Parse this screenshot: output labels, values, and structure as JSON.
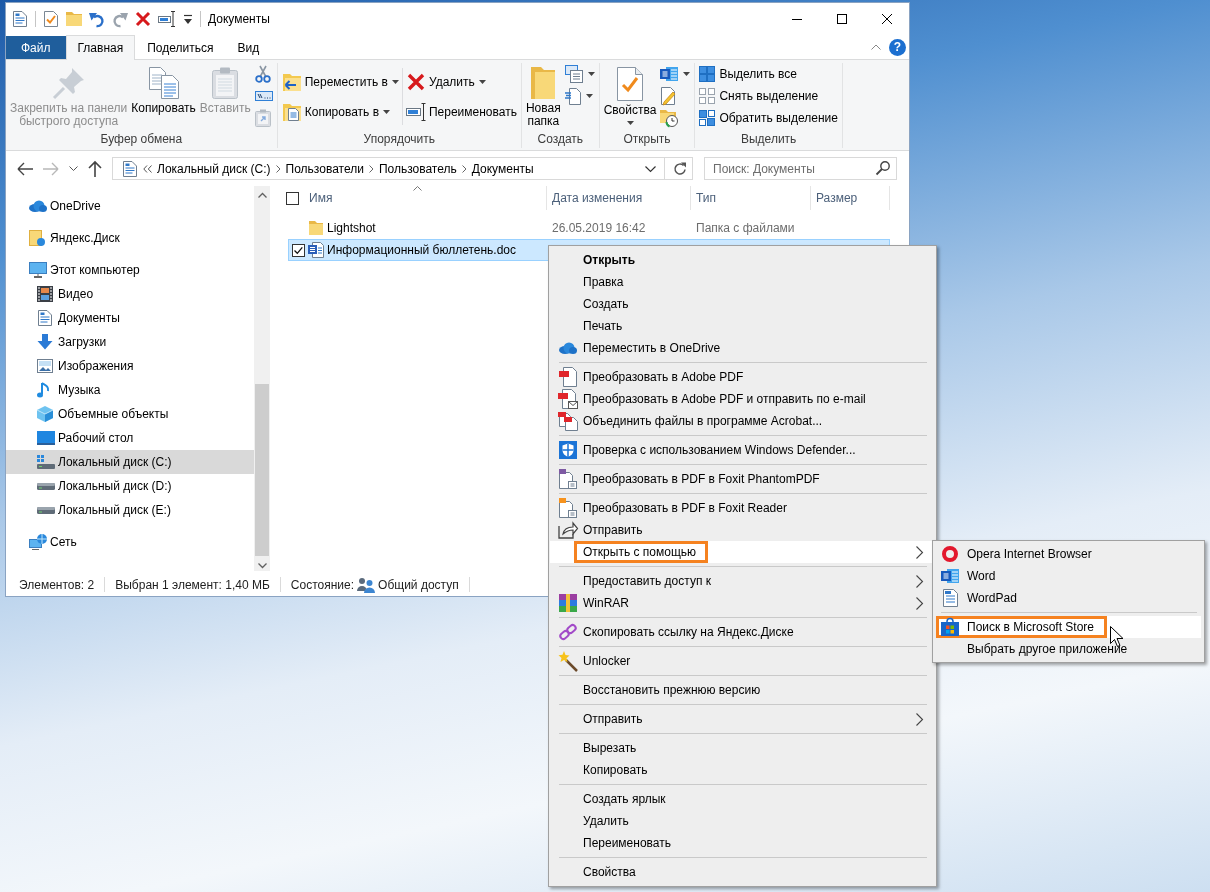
{
  "window": {
    "title": "Документы",
    "help": "?"
  },
  "ribbon": {
    "tabs": [
      {
        "label": "Файл",
        "kind": "file",
        "selected": false
      },
      {
        "label": "Главная",
        "kind": "tab",
        "selected": true
      },
      {
        "label": "Поделиться",
        "kind": "tab",
        "selected": false
      },
      {
        "label": "Вид",
        "kind": "tab",
        "selected": false
      }
    ],
    "groups": [
      {
        "label": "Буфер обмена",
        "columns": [
          [
            {
              "label": "Закрепить на панели\nбыстрого доступа",
              "kind": "large",
              "menu": false,
              "disabled": true
            }
          ],
          [
            {
              "label": "Копировать",
              "kind": "large",
              "menu": false,
              "disabled": false
            }
          ],
          [
            {
              "label": "Вставить",
              "kind": "large",
              "menu": false,
              "disabled": true
            }
          ],
          [
            {
              "kind": "small",
              "menu": false,
              "disabled": false
            },
            {
              "kind": "small",
              "menu": false,
              "disabled": false
            },
            {
              "kind": "small",
              "menu": false,
              "disabled": true
            }
          ]
        ]
      },
      {
        "label": "Упорядочить",
        "columns": [
          [
            {
              "label": "Переместить в",
              "kind": "medium",
              "menu": true,
              "disabled": false
            },
            {
              "label": "Копировать в",
              "kind": "medium",
              "menu": true,
              "disabled": false
            }
          ],
          [
            {
              "label": "Удалить",
              "kind": "medium",
              "menu": true,
              "disabled": false
            },
            {
              "label": "Переименовать",
              "kind": "medium",
              "menu": false,
              "disabled": false
            }
          ]
        ]
      },
      {
        "label": "Создать",
        "columns": [
          [
            {
              "label": "Новая\nпапка",
              "kind": "large",
              "menu": false,
              "disabled": false
            }
          ],
          [
            {
              "kind": "small",
              "menu": true,
              "disabled": false
            },
            {
              "kind": "small",
              "menu": true,
              "disabled": false
            }
          ]
        ]
      },
      {
        "label": "Открыть",
        "columns": [
          [
            {
              "label": "Свойства",
              "kind": "large",
              "menu": true,
              "disabled": false
            }
          ],
          [
            {
              "kind": "small",
              "menu": true,
              "disabled": false
            },
            {
              "kind": "small",
              "menu": false,
              "disabled": false
            },
            {
              "kind": "small",
              "menu": false,
              "disabled": false
            }
          ]
        ]
      },
      {
        "label": "Выделить",
        "columns": [
          [
            {
              "label": "Выделить все",
              "kind": "small",
              "menu": false,
              "disabled": false
            },
            {
              "label": "Снять выделение",
              "kind": "small",
              "menu": false,
              "disabled": false
            },
            {
              "label": "Обратить выделение",
              "kind": "small",
              "menu": false,
              "disabled": false
            }
          ]
        ]
      }
    ]
  },
  "address": {
    "crumbs": [
      "Локальный диск (C:)",
      "Пользователи",
      "Пользователь",
      "Документы"
    ]
  },
  "search": {
    "placeholder": "Поиск: Документы"
  },
  "navigation": {
    "items": [
      {
        "label": "OneDrive",
        "selected": false
      },
      {
        "label": "Яндекс.Диск",
        "selected": false
      },
      {
        "label": "Этот компьютер",
        "selected": false,
        "children": [
          {
            "label": "Видео",
            "selected": false
          },
          {
            "label": "Документы",
            "selected": false
          },
          {
            "label": "Загрузки",
            "selected": false
          },
          {
            "label": "Изображения",
            "selected": false
          },
          {
            "label": "Музыка",
            "selected": false
          },
          {
            "label": "Объемные объекты",
            "selected": false
          },
          {
            "label": "Рабочий стол",
            "selected": false
          },
          {
            "label": "Локальный диск (C:)",
            "selected": true
          },
          {
            "label": "Локальный диск (D:)",
            "selected": false
          },
          {
            "label": "Локальный диск (E:)",
            "selected": false
          }
        ]
      },
      {
        "label": "Сеть",
        "selected": false
      }
    ]
  },
  "file_list": {
    "select_all": {
      "checked": false
    },
    "columns": [
      {
        "label": "Имя",
        "sorted": true
      },
      {
        "label": "Дата изменения",
        "sorted": false
      },
      {
        "label": "Тип",
        "sorted": false
      },
      {
        "label": "Размер",
        "sorted": false
      }
    ],
    "rows": [
      {
        "name": "Lightshot",
        "kind": "folder",
        "date": "26.05.2019 16:42",
        "type": "Папка с файлами",
        "selected": false,
        "checked": false
      },
      {
        "name": "Информационный бюллетень.doc",
        "kind": "document",
        "selected": true,
        "checked": true
      }
    ]
  },
  "status_bar": {
    "count": "Элементов: 2",
    "selection": "Выбран 1 элемент: 1,40 МБ",
    "state_label": "Состояние:",
    "state_value": "Общий доступ"
  },
  "context_menu": {
    "groups": [
      {
        "items": [
          {
            "label": "Открыть",
            "kind": "default",
            "selected": false
          },
          {
            "label": "Правка",
            "kind": "plain",
            "selected": false
          },
          {
            "label": "Создать",
            "kind": "plain",
            "selected": false
          },
          {
            "label": "Печать",
            "kind": "plain",
            "selected": false
          },
          {
            "label": "Переместить в OneDrive",
            "kind": "plain",
            "selected": false
          }
        ]
      },
      {
        "items": [
          {
            "label": "Преобразовать в Adobe PDF",
            "kind": "plain",
            "selected": false
          },
          {
            "label": "Преобразовать в Adobe PDF и отправить по e-mail",
            "kind": "plain",
            "selected": false
          },
          {
            "label": "Объединить файлы в программе Acrobat...",
            "kind": "plain",
            "selected": false
          }
        ]
      },
      {
        "items": [
          {
            "label": "Проверка с использованием Windows Defender...",
            "kind": "plain",
            "selected": false
          }
        ]
      },
      {
        "items": [
          {
            "label": "Преобразовать в PDF в Foxit PhantomPDF",
            "kind": "plain",
            "selected": false
          }
        ]
      },
      {
        "items": [
          {
            "label": "Преобразовать в PDF в Foxit Reader",
            "kind": "plain",
            "selected": false
          },
          {
            "label": "Отправить",
            "kind": "plain",
            "selected": false
          },
          {
            "label": "Открыть с помощью",
            "kind": "submenu",
            "selected": true
          }
        ]
      },
      {
        "items": [
          {
            "label": "Предоставить доступ к",
            "kind": "submenu",
            "selected": false
          },
          {
            "label": "WinRAR",
            "kind": "submenu",
            "selected": false
          }
        ]
      },
      {
        "items": [
          {
            "label": "Скопировать ссылку на Яндекс.Диске",
            "kind": "plain",
            "selected": false
          }
        ]
      },
      {
        "items": [
          {
            "label": "Unlocker",
            "kind": "plain",
            "selected": false
          }
        ]
      },
      {
        "items": [
          {
            "label": "Восстановить прежнюю версию",
            "kind": "plain",
            "selected": false
          }
        ]
      },
      {
        "items": [
          {
            "label": "Отправить",
            "kind": "submenu",
            "selected": false
          }
        ]
      },
      {
        "items": [
          {
            "label": "Вырезать",
            "kind": "plain",
            "selected": false
          },
          {
            "label": "Копировать",
            "kind": "plain",
            "selected": false
          }
        ]
      },
      {
        "items": [
          {
            "label": "Создать ярлык",
            "kind": "plain",
            "selected": false
          },
          {
            "label": "Удалить",
            "kind": "plain",
            "selected": false
          },
          {
            "label": "Переименовать",
            "kind": "plain",
            "selected": false
          }
        ]
      },
      {
        "items": [
          {
            "label": "Свойства",
            "kind": "plain",
            "selected": false
          }
        ]
      }
    ]
  },
  "submenu": {
    "groups": [
      {
        "items": [
          {
            "label": "Opera Internet Browser",
            "kind": "plain",
            "selected": false
          },
          {
            "label": "Word",
            "kind": "plain",
            "selected": false
          },
          {
            "label": "WordPad",
            "kind": "plain",
            "selected": false
          }
        ]
      },
      {
        "items": [
          {
            "label": "Поиск в Microsoft Store",
            "kind": "plain",
            "selected": true
          },
          {
            "label": "Выбрать другое приложение",
            "kind": "plain",
            "selected": false
          }
        ]
      }
    ]
  }
}
